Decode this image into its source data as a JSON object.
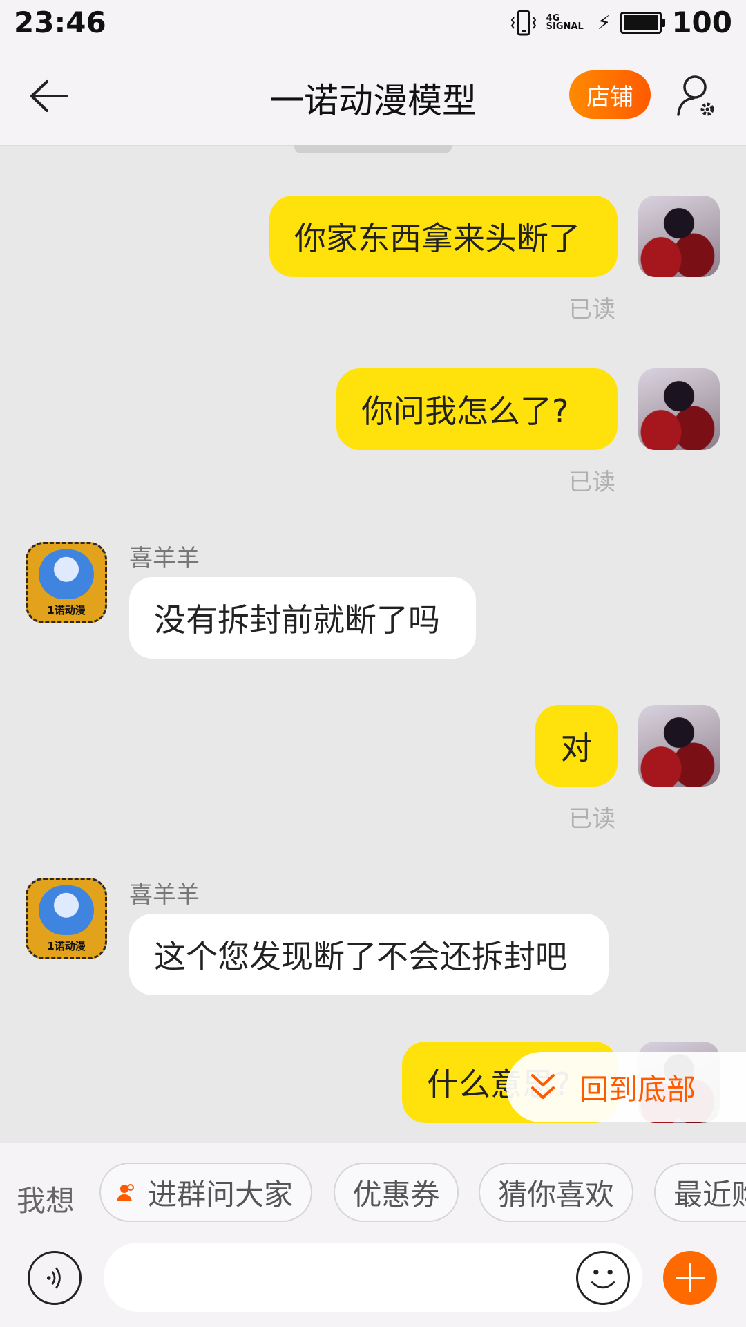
{
  "status_bar": {
    "time": "23:46",
    "signal": "4G SIGNAL",
    "battery_level": "100"
  },
  "header": {
    "title": "一诺动漫模型",
    "shop_label": "店铺"
  },
  "colors": {
    "accent": "#ff6a00",
    "outgoing_bubble": "#ffe20c",
    "incoming_bubble": "#ffffff",
    "background": "#e8e8e8"
  },
  "messages": [
    {
      "direction": "out",
      "text": "你家东西拿来头断了",
      "status": "已读"
    },
    {
      "direction": "out",
      "text": "你问我怎么了?",
      "status": "已读"
    },
    {
      "direction": "in",
      "sender": "喜羊羊",
      "text": "没有拆封前就断了吗"
    },
    {
      "direction": "out",
      "text": "对",
      "status": "已读"
    },
    {
      "direction": "in",
      "sender": "喜羊羊",
      "text": "这个您发现断了不会还拆封吧"
    },
    {
      "direction": "out",
      "text": "什么意思?"
    }
  ],
  "shop_avatar_text": "1诺动漫",
  "back_to_bottom": {
    "label": "回到底部"
  },
  "quick_actions": {
    "label": "我想",
    "chips": [
      "进群问大家",
      "优惠券",
      "猜你喜欢",
      "最近购"
    ]
  },
  "input": {
    "placeholder": ""
  },
  "icons": [
    "back-arrow-icon",
    "profile-settings-icon",
    "double-chevron-down-icon",
    "voice-icon",
    "emoji-icon",
    "plus-icon"
  ]
}
